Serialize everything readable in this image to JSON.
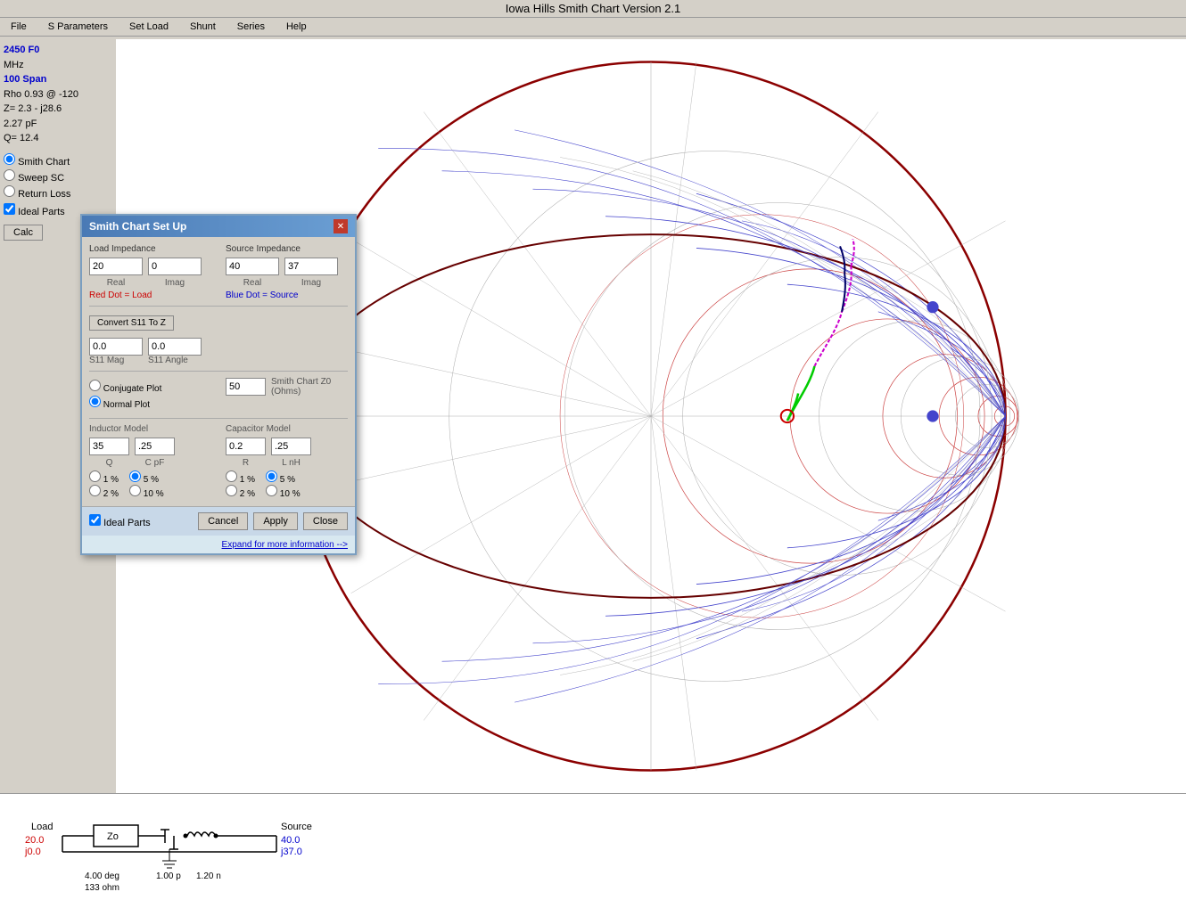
{
  "app": {
    "title": "Iowa Hills Smith Chart  Version 2.1",
    "window_icon": "chart-icon"
  },
  "menu": {
    "items": [
      "File",
      "S Parameters",
      "Set Load",
      "Shunt",
      "Series",
      "Help"
    ]
  },
  "left_panel": {
    "f0_label": "F0",
    "f0_value": "2450",
    "f0_unit": "MHz",
    "span_label": "Span",
    "span_value": "100",
    "rho_label": "Rho",
    "rho_value": "0.93 @ -120",
    "z_label": "Z=",
    "z_value": "2.3 - j28.6",
    "c_value": "2.27 pF",
    "q_value": "Q= 12.4",
    "radio_options": [
      "Smith Chart",
      "Sweep SC",
      "Return Loss"
    ],
    "radio_selected": 0,
    "ideal_parts_label": "Ideal Parts",
    "ideal_parts_checked": true,
    "calc_btn": "Calc"
  },
  "setup_dialog": {
    "title": "Smith Chart Set Up",
    "load_impedance": {
      "label": "Load Impedance",
      "real": "20",
      "imag": "0",
      "real_label": "Real",
      "imag_label": "Imag",
      "note": "Red Dot = Load"
    },
    "source_impedance": {
      "label": "Source Impedance",
      "real": "40",
      "imag": "37",
      "real_label": "Real",
      "imag_label": "Imag",
      "note": "Blue Dot = Source"
    },
    "convert_btn": "Convert S11 To Z",
    "s11_mag": "0.0",
    "s11_angle": "0.0",
    "s11_mag_label": "S11 Mag",
    "s11_angle_label": "S11 Angle",
    "plot_options": [
      "Conjugate Plot",
      "Normal Plot"
    ],
    "plot_selected": 1,
    "smith_chart_z0_label": "Smith Chart Z0 (Ohms)",
    "smith_chart_z0": "50",
    "inductor_model": {
      "label": "Inductor Model",
      "q": "35",
      "c_pf": ".25",
      "q_label": "Q",
      "c_label": "C pF",
      "tolerance_options": [
        "1 %",
        "2 %",
        "5 %",
        "10 %"
      ],
      "tolerance_selected": 1
    },
    "capacitor_model": {
      "label": "Capacitor Model",
      "r": "0.2",
      "l_nh": ".25",
      "r_label": "R",
      "l_label": "L nH",
      "tolerance_options": [
        "1 %",
        "2 %",
        "5 %",
        "10 %"
      ],
      "tolerance_selected": 1
    },
    "ideal_parts_label": "Ideal Parts",
    "ideal_parts_checked": true,
    "cancel_btn": "Cancel",
    "apply_btn": "Apply",
    "close_btn": "Close",
    "expand_link": "Expand for more information -->"
  },
  "circuit": {
    "load_label": "Load",
    "load_real": "20.0",
    "load_imag": "j0.0",
    "source_label": "Source",
    "source_real": "40.0",
    "source_imag": "j37.0",
    "zo_label": "Zo",
    "deg_value": "4.00 deg",
    "cap_value": "1.00 p",
    "ind_value": "1.20 n",
    "ohm_value": "133 ohm"
  },
  "colors": {
    "accent_blue": "#4a7ab5",
    "text_red": "#cc0000",
    "text_blue": "#0000cc",
    "chart_bg": "#ffffff",
    "dialog_bg": "#d4d0c8",
    "smith_red": "#cc0000",
    "smith_blue": "#0000cc",
    "smith_gray": "#999999",
    "smith_dark": "#660000"
  }
}
